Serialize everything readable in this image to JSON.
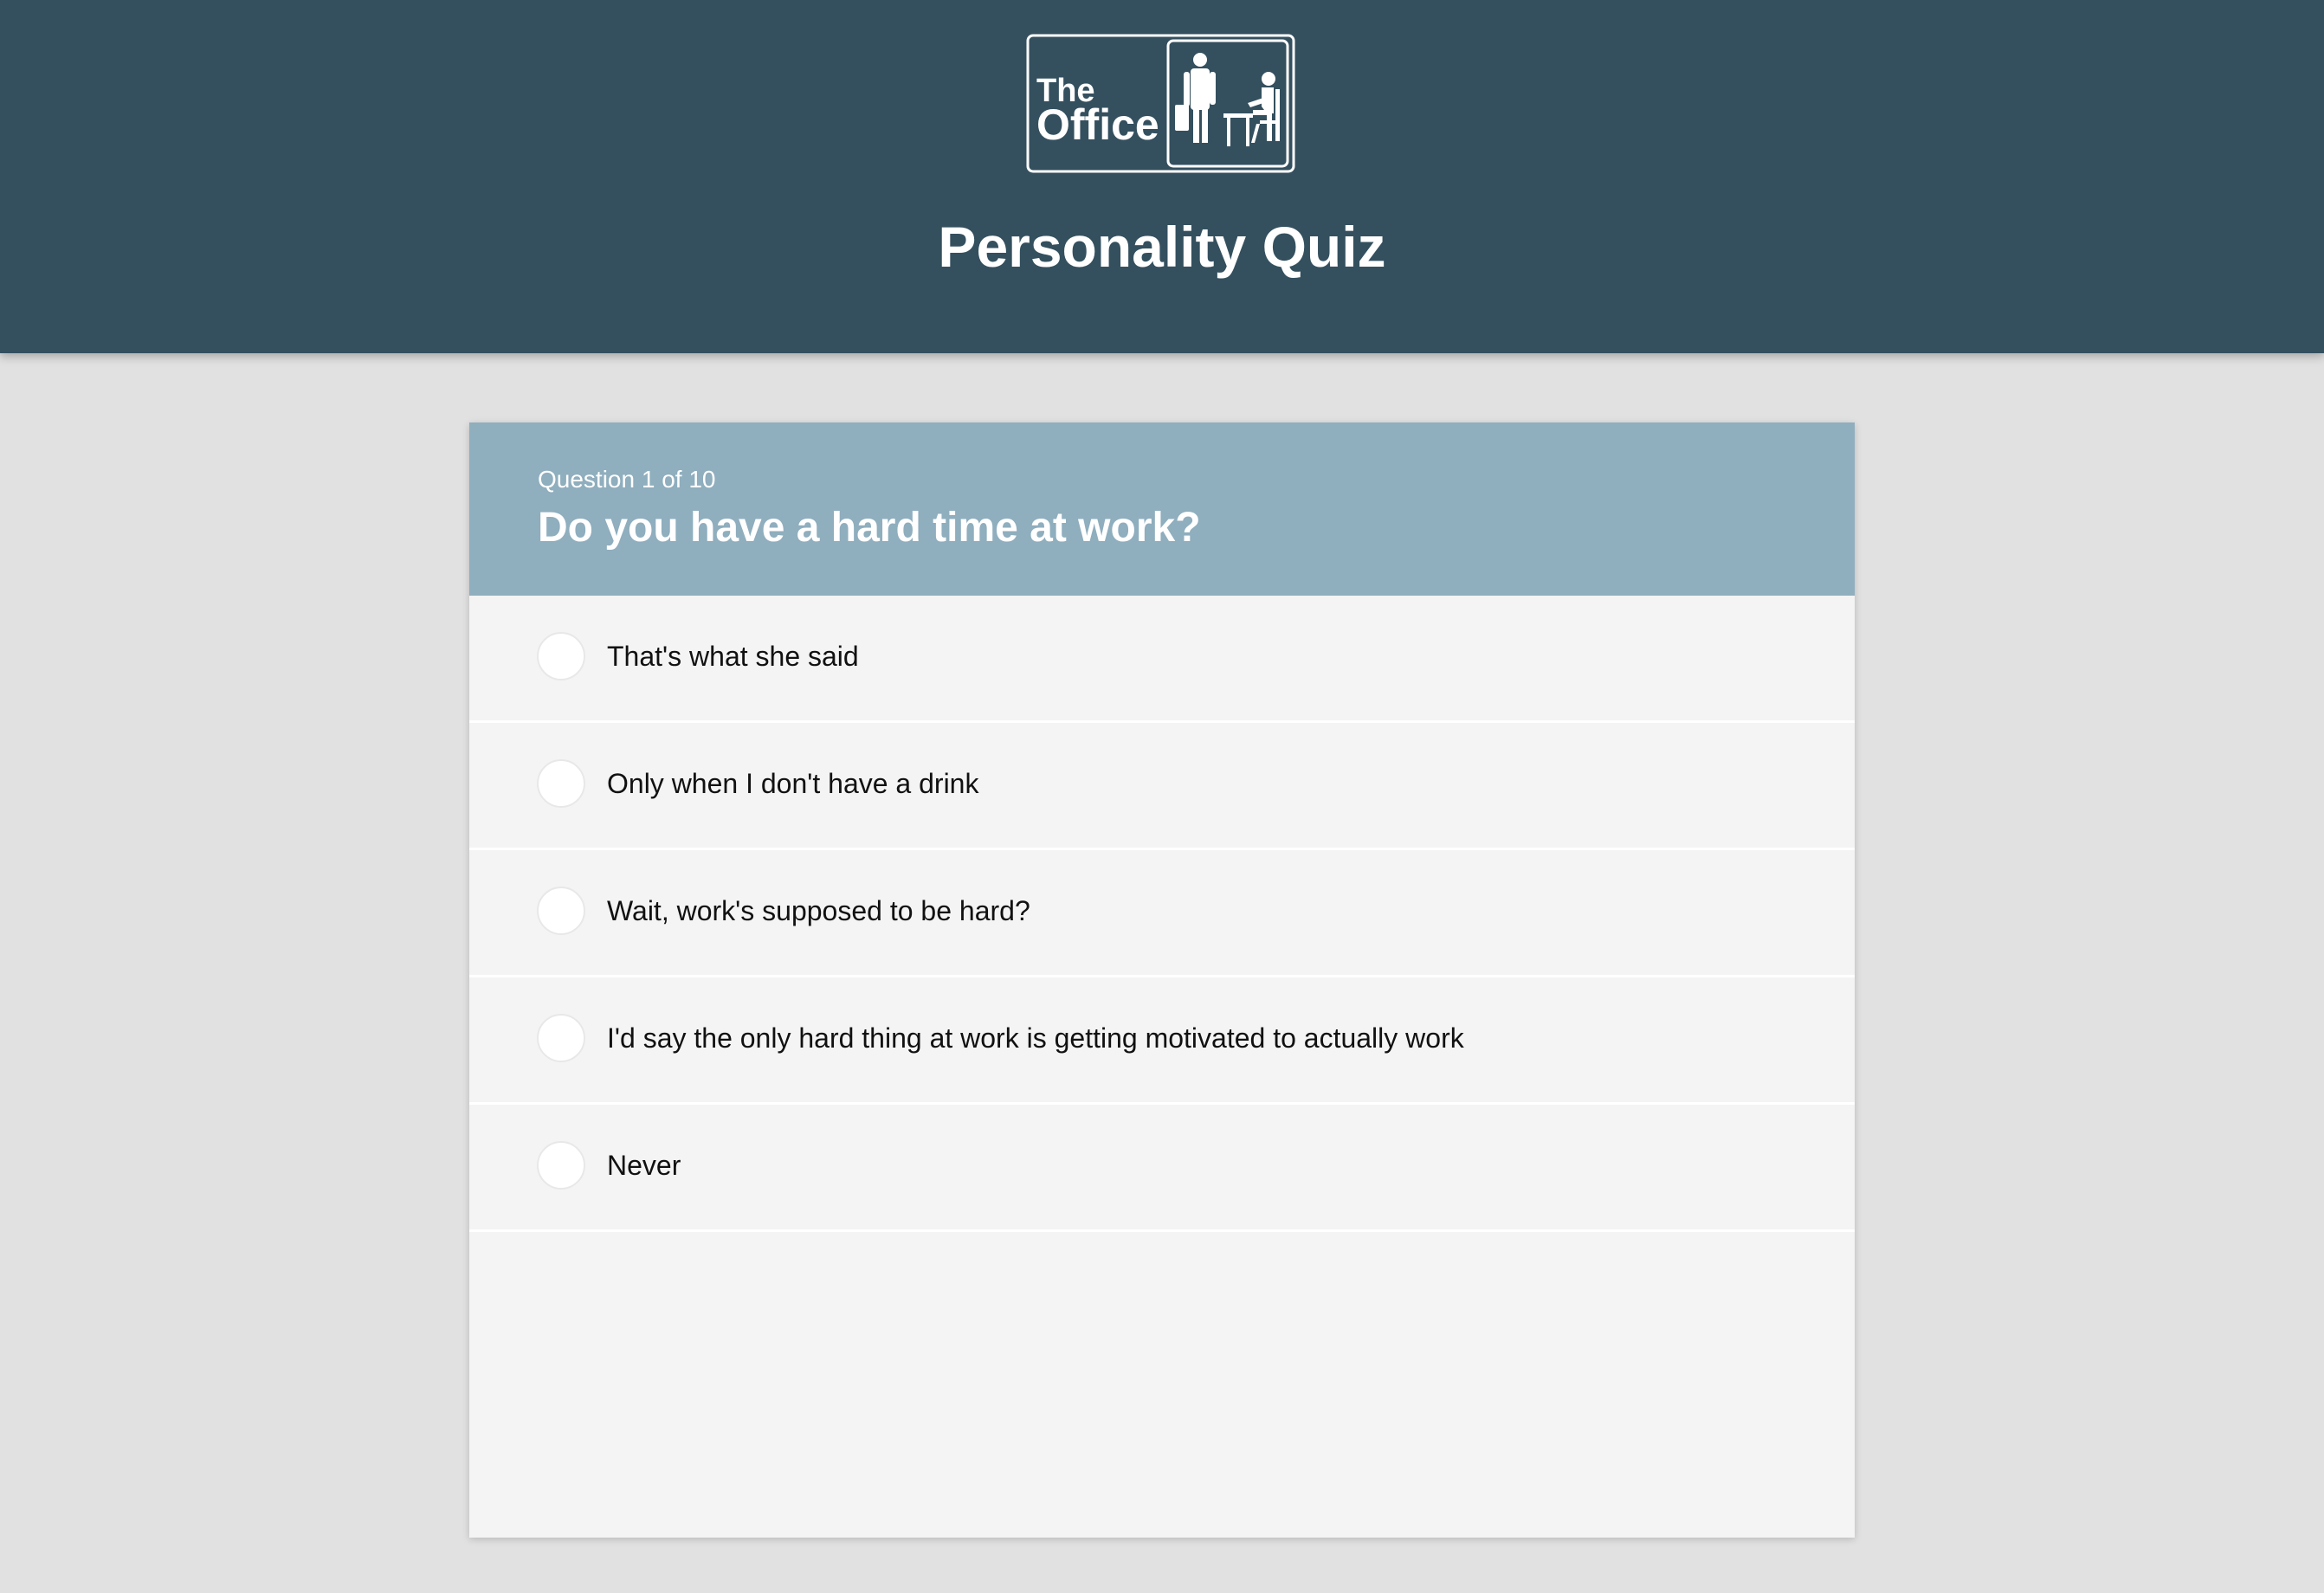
{
  "header": {
    "logo_line1": "The",
    "logo_line2": "Office",
    "title": "Personality Quiz"
  },
  "question": {
    "counter": "Question 1 of 10",
    "text": "Do you have a hard time at work?"
  },
  "answers": [
    {
      "label": "That's what she said"
    },
    {
      "label": "Only when I don't have a drink"
    },
    {
      "label": "Wait, work's supposed to be hard?"
    },
    {
      "label": "I'd say the only hard thing at work is getting motivated to actually work"
    },
    {
      "label": "Never"
    }
  ],
  "colors": {
    "header_bg": "#34505f",
    "question_header_bg": "#8faebe",
    "page_bg": "#e1e1e1",
    "card_bg": "#f4f4f4"
  }
}
